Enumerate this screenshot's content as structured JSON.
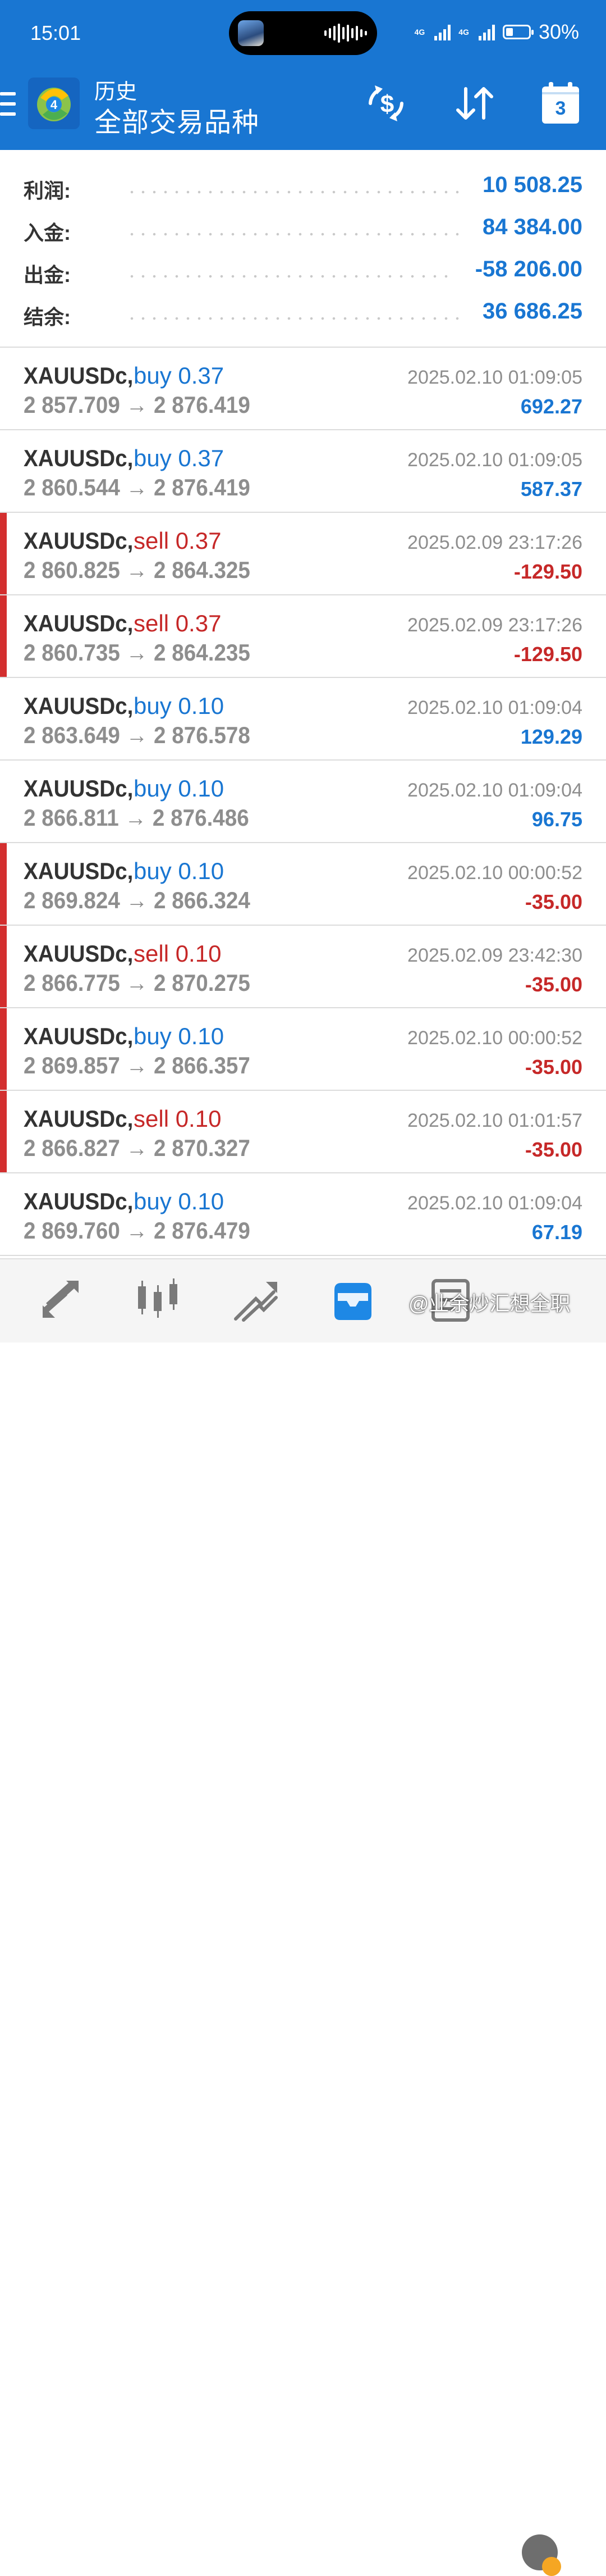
{
  "status_bar": {
    "time": "15:01",
    "network_1": "4G",
    "network_2": "4G",
    "battery": "30%"
  },
  "app_bar": {
    "title": "历史",
    "subtitle": "全部交易品种",
    "calendar_day": "3",
    "accent_color": "#1976d2",
    "icons": [
      "menu-icon",
      "app-logo-icon",
      "balance-operations-icon",
      "sort-icon",
      "calendar-icon"
    ]
  },
  "summary": [
    {
      "label": "利润:",
      "value": "10 508.25"
    },
    {
      "label": "入金:",
      "value": "84 384.00"
    },
    {
      "label": "出金:",
      "value": "-58 206.00"
    },
    {
      "label": "结余:",
      "value": "36 686.25"
    }
  ],
  "trades": [
    {
      "symbol": "XAUUSDc,",
      "side": "buy",
      "side_text": "buy 0.37",
      "prices": "2 857.709 → 2 876.419",
      "time": "2025.02.10 01:09:05",
      "profit": "692.27",
      "loss": false
    },
    {
      "symbol": "XAUUSDc,",
      "side": "buy",
      "side_text": "buy 0.37",
      "prices": "2 860.544 → 2 876.419",
      "time": "2025.02.10 01:09:05",
      "profit": "587.37",
      "loss": false
    },
    {
      "symbol": "XAUUSDc,",
      "side": "sell",
      "side_text": "sell 0.37",
      "prices": "2 860.825 → 2 864.325",
      "time": "2025.02.09 23:17:26",
      "profit": "-129.50",
      "loss": true
    },
    {
      "symbol": "XAUUSDc,",
      "side": "sell",
      "side_text": "sell 0.37",
      "prices": "2 860.735 → 2 864.235",
      "time": "2025.02.09 23:17:26",
      "profit": "-129.50",
      "loss": true
    },
    {
      "symbol": "XAUUSDc,",
      "side": "buy",
      "side_text": "buy 0.10",
      "prices": "2 863.649 → 2 876.578",
      "time": "2025.02.10 01:09:04",
      "profit": "129.29",
      "loss": false
    },
    {
      "symbol": "XAUUSDc,",
      "side": "buy",
      "side_text": "buy 0.10",
      "prices": "2 866.811 → 2 876.486",
      "time": "2025.02.10 01:09:04",
      "profit": "96.75",
      "loss": false
    },
    {
      "symbol": "XAUUSDc,",
      "side": "buy",
      "side_text": "buy 0.10",
      "prices": "2 869.824 → 2 866.324",
      "time": "2025.02.10 00:00:52",
      "profit": "-35.00",
      "loss": true
    },
    {
      "symbol": "XAUUSDc,",
      "side": "sell",
      "side_text": "sell 0.10",
      "prices": "2 866.775 → 2 870.275",
      "time": "2025.02.09 23:42:30",
      "profit": "-35.00",
      "loss": true
    },
    {
      "symbol": "XAUUSDc,",
      "side": "buy",
      "side_text": "buy 0.10",
      "prices": "2 869.857 → 2 866.357",
      "time": "2025.02.10 00:00:52",
      "profit": "-35.00",
      "loss": true
    },
    {
      "symbol": "XAUUSDc,",
      "side": "sell",
      "side_text": "sell 0.10",
      "prices": "2 866.827 → 2 870.327",
      "time": "2025.02.10 01:01:57",
      "profit": "-35.00",
      "loss": true
    },
    {
      "symbol": "XAUUSDc,",
      "side": "buy",
      "side_text": "buy 0.10",
      "prices": "2 869.760 → 2 876.479",
      "time": "2025.02.10 01:09:04",
      "profit": "67.19",
      "loss": false
    }
  ],
  "bottom_nav": {
    "items": [
      "quotes-icon",
      "chart-icon",
      "trade-icon",
      "history-icon",
      "messages-icon"
    ],
    "active": "history-icon"
  },
  "watermark": {
    "text": "@业余炒汇想全职"
  }
}
